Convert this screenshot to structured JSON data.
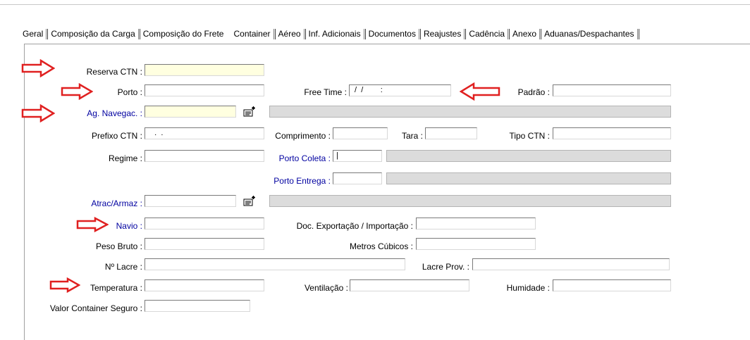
{
  "tabs": [
    "Geral",
    "Composição da Carga",
    "Composição do Frete",
    "Container",
    "Aéreo",
    "Inf. Adicionais",
    "Documentos",
    "Reajustes",
    "Cadência",
    "Anexo",
    "Aduanas/Despachantes"
  ],
  "labels": {
    "reserva": "Reserva CTN :",
    "porto": "Porto :",
    "free_time": "Free Time :",
    "padrao": "Padrão :",
    "ag_navegac": "Ag. Navegac. :",
    "prefixo": "Prefixo CTN :",
    "comprimento": "Comprimento :",
    "tara": "Tara :",
    "tipo_ctn": "Tipo CTN :",
    "regime": "Regime :",
    "porto_coleta": "Porto Coleta :",
    "porto_entrega": "Porto Entrega :",
    "atrac": "Atrac/Armaz :",
    "navio": "Navio :",
    "doc_exp": "Doc. Exportação / Importação :",
    "peso_bruto": "Peso Bruto :",
    "metros_cubicos": "Metros Cúbicos :",
    "lacre": "Nº Lacre :",
    "lacre_prov": "Lacre Prov. :",
    "temperatura": "Temperatura :",
    "ventilacao": "Ventilação :",
    "humidade": "Humidade :",
    "valor_seguro": "Valor Container Seguro :"
  },
  "values": {
    "free_time": " /  /        :",
    "prefixo": "   .  .  ",
    "porto_coleta": "|"
  },
  "colors": {
    "yellow_field": "#ffffe0",
    "gray_field": "#dcdcdc",
    "blue_label": "#0000a0",
    "arrow": "#e02020"
  },
  "icons": {
    "lookup": "lookup-icon",
    "arrow": "red-arrow-annotation"
  }
}
